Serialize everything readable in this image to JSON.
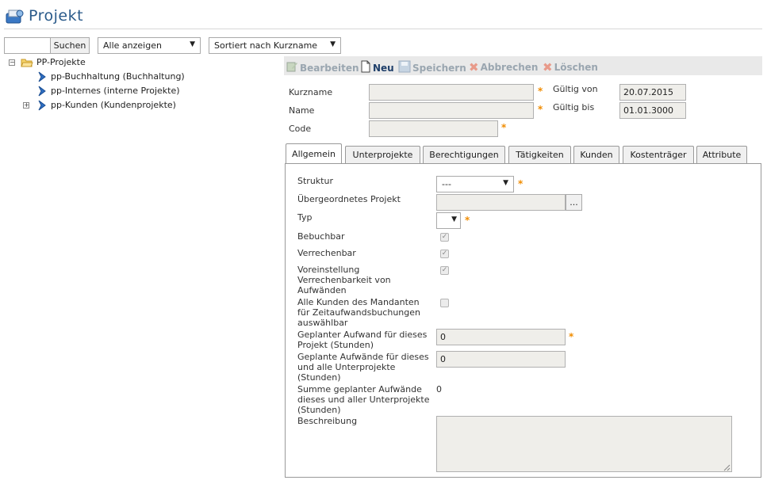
{
  "header": {
    "title": "Projekt",
    "icon": "project-icon"
  },
  "search": {
    "value": "",
    "button_label": "Suchen"
  },
  "filter": {
    "selected": "Alle anzeigen"
  },
  "sort": {
    "selected": "Sortiert nach Kurzname"
  },
  "tree": {
    "root": "PP-Projekte",
    "items": [
      {
        "label": "pp-Buchhaltung (Buchhaltung)"
      },
      {
        "label": "pp-Internes (interne Projekte)"
      },
      {
        "label": "pp-Kunden (Kundenprojekte)"
      }
    ]
  },
  "toolbar": {
    "edit": "Bearbeiten",
    "new": "Neu",
    "save": "Speichern",
    "cancel": "Abbrechen",
    "delete": "Löschen"
  },
  "form": {
    "kurzname_label": "Kurzname",
    "name_label": "Name",
    "code_label": "Code",
    "valid_from_label": "Gültig von",
    "valid_from_value": "20.07.2015",
    "valid_to_label": "Gültig bis",
    "valid_to_value": "01.01.3000",
    "required_mark": "*"
  },
  "tabs": [
    {
      "label": "Allgemein"
    },
    {
      "label": "Unterprojekte"
    },
    {
      "label": "Berechtigungen"
    },
    {
      "label": "Tätigkeiten"
    },
    {
      "label": "Kunden"
    },
    {
      "label": "Kostenträger"
    },
    {
      "label": "Attribute"
    }
  ],
  "general": {
    "struktur_label": "Struktur",
    "struktur_value": "---",
    "parent_label": "Übergeordnetes Projekt",
    "browse_label": "...",
    "typ_label": "Typ",
    "bookable_label": "Bebuchbar",
    "billable_label": "Verrechenbar",
    "default_billable_label": "Voreinstellung Verrechenbarkeit von Aufwänden",
    "all_customers_label": "Alle Kunden des Mandanten für Zeitaufwandsbuchungen auswählbar",
    "planned_label": "Geplanter Aufwand für dieses Projekt (Stunden)",
    "planned_value": "0",
    "planned_all_label": "Geplante Aufwände für dieses und alle Unterprojekte (Stunden)",
    "planned_all_value": "0",
    "sum_label": "Summe geplanter Aufwände dieses und aller Unterprojekte (Stunden)",
    "sum_value": "0",
    "description_label": "Beschreibung",
    "check_mark": "✓"
  }
}
